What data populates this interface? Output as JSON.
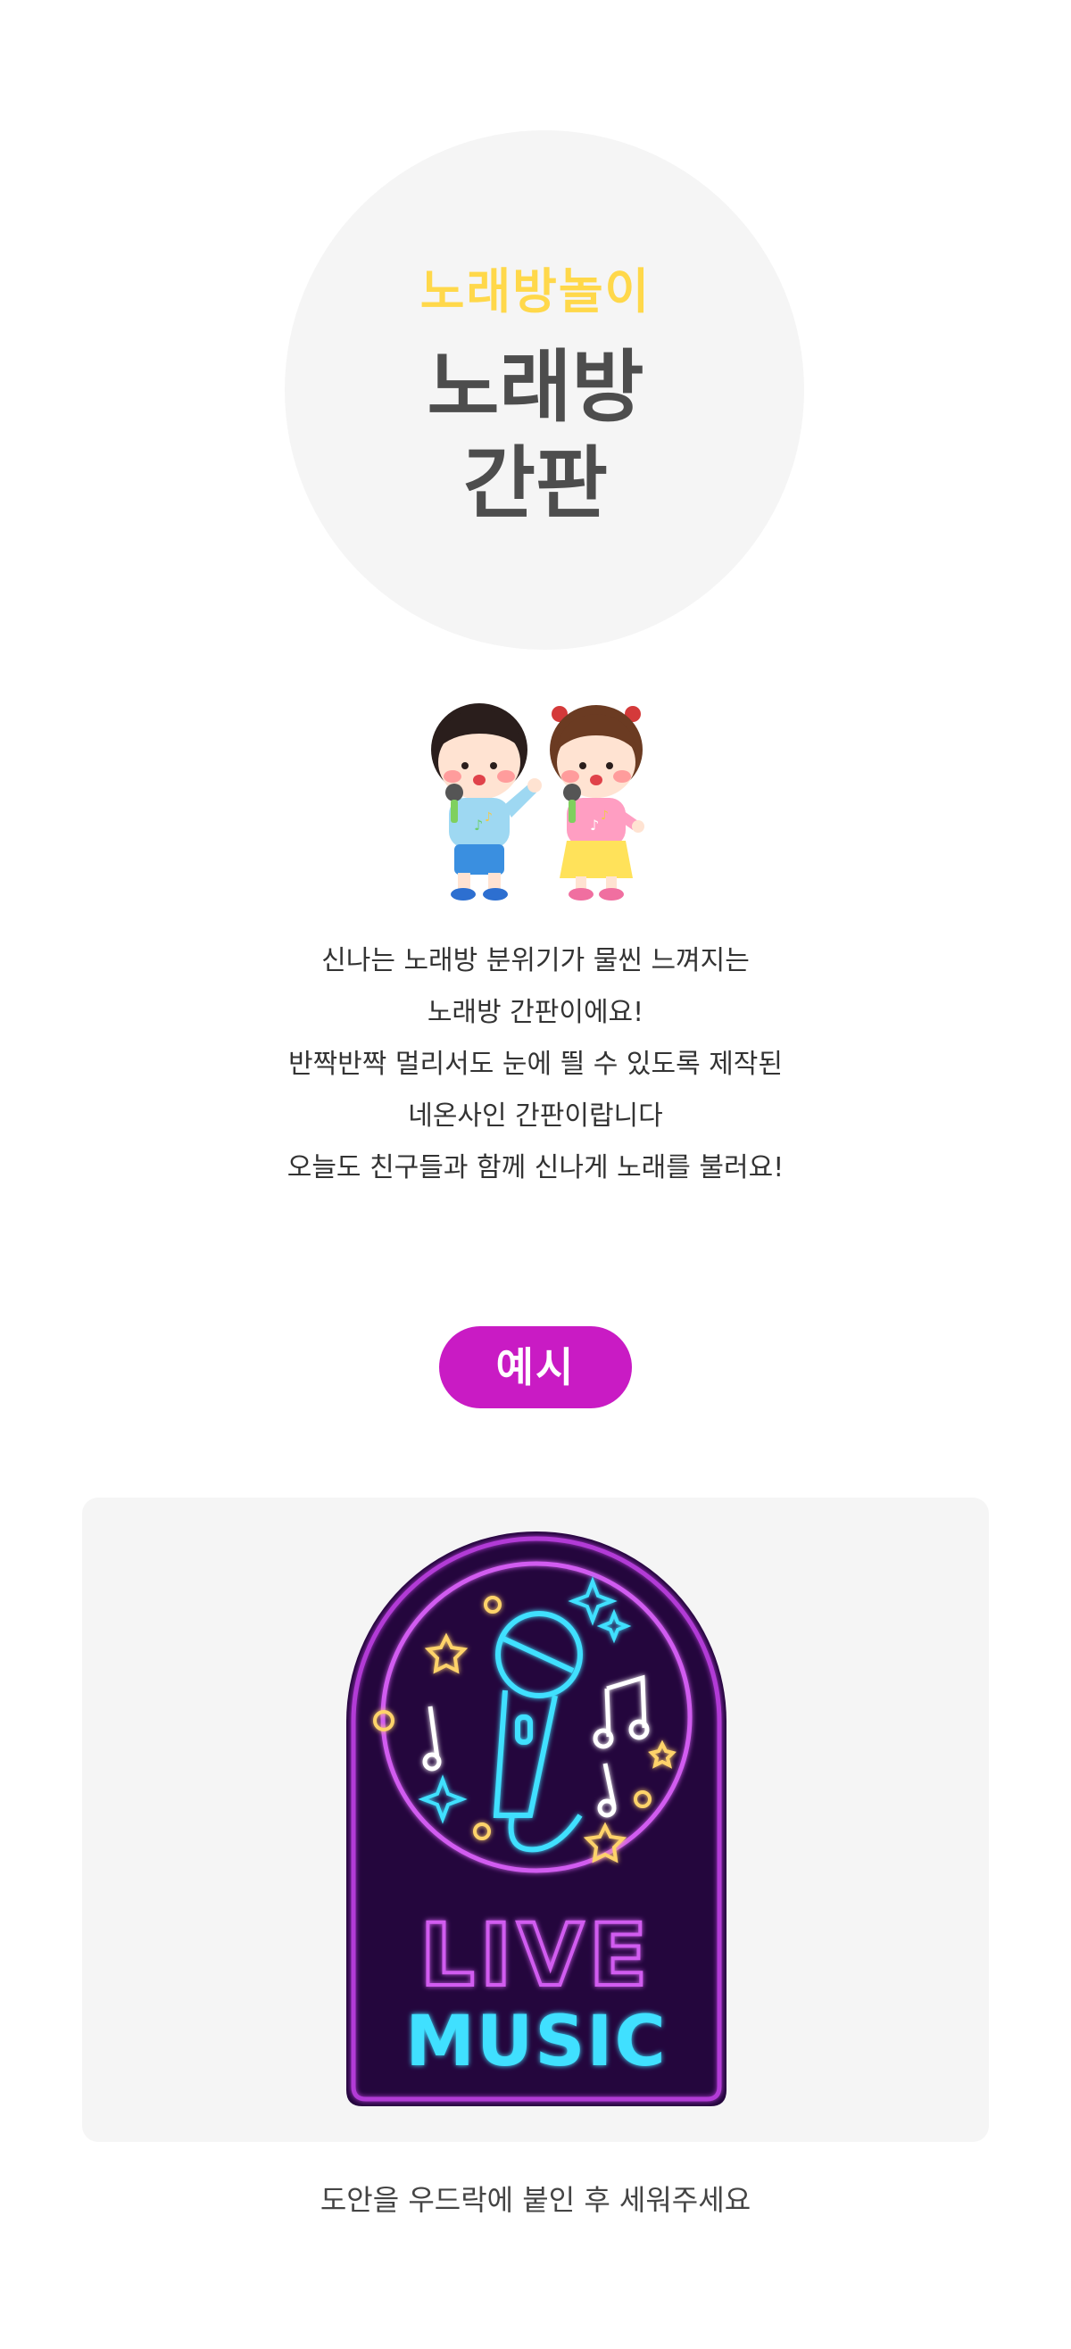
{
  "hero": {
    "subtitle": "노래방놀이",
    "title_line1": "노래방",
    "title_line2": "간판"
  },
  "illustration": {
    "icon": "kids-singing-illustration"
  },
  "description": {
    "lines": [
      "신나는 노래방 분위기가 물씬 느껴지는",
      "노래방 간판이에요!",
      "반짝반짝 멀리서도 눈에 띌 수 있도록 제작된",
      "네온사인 간판이랍니다",
      "오늘도 친구들과 함께 신나게 노래를 불러요!"
    ]
  },
  "example": {
    "badge_label": "예시",
    "sign": {
      "word1": "LIVE",
      "word2": "MUSIC",
      "icon": "neon-microphone-icon",
      "colors": {
        "background": "#24063d",
        "neon_pink": "#d15cf0",
        "neon_cyan": "#3fe0ff",
        "neon_yellow": "#ffd36b"
      }
    }
  },
  "footer": {
    "note": "도안을 우드락에 붙인 후 세워주세요"
  },
  "colors": {
    "accent_magenta": "#c91bc4",
    "subtitle_yellow": "#ffd84a",
    "title_gray": "#4d4d4d",
    "panel_gray": "#f5f5f5"
  }
}
